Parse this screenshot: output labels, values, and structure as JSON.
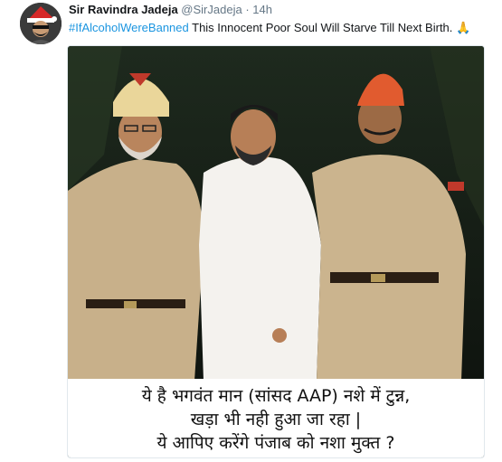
{
  "author": {
    "display_name": "Sir Ravindra Jadeja",
    "handle": "@SirJadeja",
    "separator": "·",
    "time": "14h"
  },
  "tweet": {
    "hashtag": "#IfAlcoholWereBanned",
    "text": " This Innocent Poor Soul Will Starve Till Next Birth. ",
    "emoji": "🙏"
  },
  "media": {
    "caption_lines": [
      "ये है भगवंत मान (सांसद AAP) नशे में टुन्न,",
      "खड़ा भी नही हुआ जा रहा |",
      "ये आपिए करेंगे पंजाब को नशा मुक्त ?"
    ]
  },
  "colors": {
    "link": "#1b95e0",
    "text": "#14171a",
    "muted": "#657786"
  }
}
